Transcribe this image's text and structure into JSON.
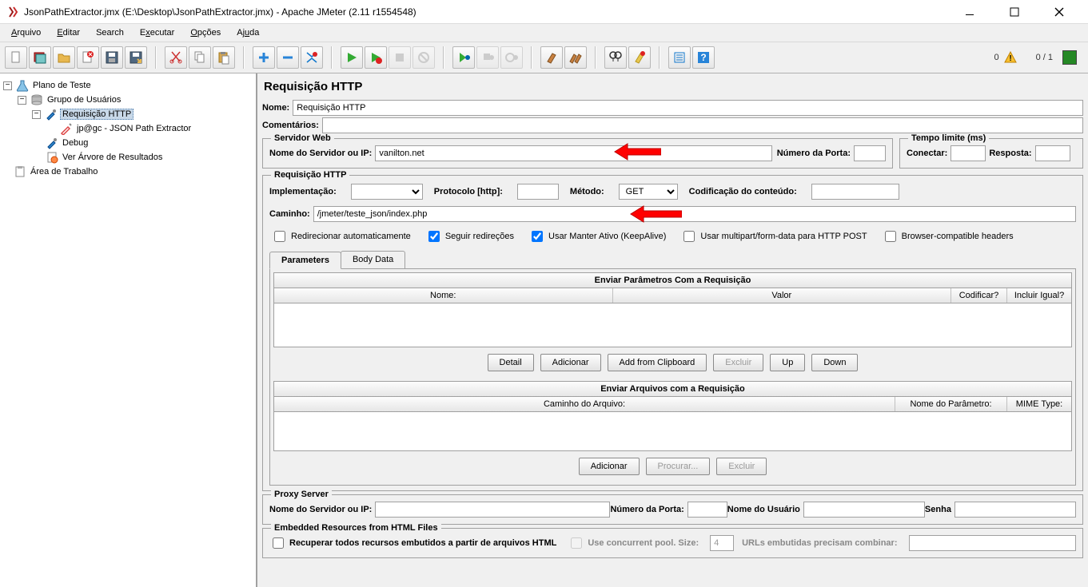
{
  "titlebar": {
    "title": "JsonPathExtractor.jmx (E:\\Desktop\\JsonPathExtractor.jmx) - Apache JMeter (2.11 r1554548)"
  },
  "menu": {
    "arquivo": "Arquivo",
    "editar": "Editar",
    "search": "Search",
    "executar": "Executar",
    "opcoes": "Opções",
    "ajuda": "Ajuda"
  },
  "status": {
    "zero": "0",
    "warn": "!",
    "counter": "0 / 1"
  },
  "tree": {
    "n0": {
      "label": "Plano de Teste"
    },
    "n1": {
      "label": "Grupo de Usuários"
    },
    "n2": {
      "label": "Requisição HTTP"
    },
    "n3": {
      "label": "jp@gc - JSON Path Extractor"
    },
    "n4": {
      "label": "Debug"
    },
    "n5": {
      "label": "Ver Árvore de Resultados"
    },
    "n6": {
      "label": "Área de Trabalho"
    }
  },
  "panel": {
    "title": "Requisição HTTP",
    "nome_label": "Nome:",
    "nome_value": "Requisição HTTP",
    "comentarios_label": "Comentários:",
    "web": {
      "legend": "Servidor Web",
      "server_label": "Nome do Servidor ou IP:",
      "server_value": "vanilton.net",
      "port_label": "Número da Porta:"
    },
    "timeout": {
      "legend": "Tempo limite (ms)",
      "connect": "Conectar:",
      "response": "Resposta:"
    },
    "http": {
      "legend": "Requisição HTTP",
      "impl": "Implementação:",
      "proto": "Protocolo [http]:",
      "metodo": "Método:",
      "metodo_value": "GET",
      "encoding": "Codificação do conteúdo:",
      "caminho": "Caminho:",
      "caminho_value": "/jmeter/teste_json/index.php",
      "cb1": "Redirecionar automaticamente",
      "cb2": "Seguir redireções",
      "cb3": "Usar Manter Ativo (KeepAlive)",
      "cb4": "Usar multipart/form-data para HTTP POST",
      "cb5": "Browser-compatible headers"
    },
    "tabs": {
      "parameters": "Parameters",
      "body": "Body Data"
    },
    "params": {
      "title": "Enviar Parâmetros Com a Requisição",
      "col_nome": "Nome:",
      "col_valor": "Valor",
      "col_cod": "Codificar?",
      "col_inc": "Incluir Igual?",
      "btn_detail": "Detail",
      "btn_add": "Adicionar",
      "btn_clip": "Add from Clipboard",
      "btn_del": "Excluir",
      "btn_up": "Up",
      "btn_down": "Down"
    },
    "files": {
      "title": "Enviar Arquivos com a Requisição",
      "col_path": "Caminho do Arquivo:",
      "col_param": "Nome do Parâmetro:",
      "col_mime": "MIME Type:",
      "btn_add": "Adicionar",
      "btn_browse": "Procurar...",
      "btn_del": "Excluir"
    },
    "proxy": {
      "legend": "Proxy Server",
      "server": "Nome do Servidor ou IP:",
      "port": "Número da Porta:",
      "user": "Nome do Usuário",
      "pass": "Senha"
    },
    "embedded": {
      "legend": "Embedded Resources from HTML Files",
      "cb": "Recuperar todos recursos embutidos a partir de arquivos HTML",
      "pool": "Use concurrent pool. Size:",
      "pool_value": "4",
      "match": "URLs embutidas precisam combinar:"
    }
  }
}
